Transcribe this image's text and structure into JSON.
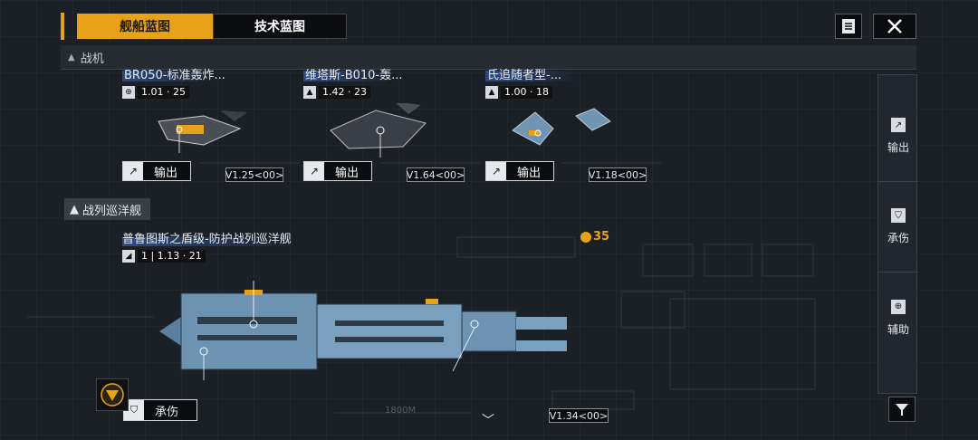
{
  "tabs": {
    "ship_blueprint": "舰船蓝图",
    "tech_blueprint": "技术蓝图"
  },
  "sections": {
    "fighters": "战机",
    "battlecruisers": "战列巡洋舰"
  },
  "fighters": [
    {
      "name": "BR050-标准轰炸...",
      "version": "1.01",
      "version_sub": "25",
      "role": "输出",
      "ver_tag": "V1.25<00>"
    },
    {
      "name": "维塔斯-B010-轰...",
      "version": "1.42",
      "version_sub": "23",
      "role": "输出",
      "ver_tag": "V1.64<00>"
    },
    {
      "name": "氏追随者型-...",
      "version": "1.00",
      "version_sub": "18",
      "role": "输出",
      "ver_tag": "V1.18<00>"
    }
  ],
  "battlecruiser": {
    "name": "普鲁图斯之盾级-防护战列巡洋舰",
    "version": "1.13",
    "version_prefix": "1",
    "version_sub": "21",
    "count": "35",
    "role": "承伤",
    "ver_tag": "V1.34<00>",
    "range_label": "1800M"
  },
  "side_filters": [
    {
      "label": "输出",
      "icon": "arrow-diagonal-icon"
    },
    {
      "label": "承伤",
      "icon": "shield-icon"
    },
    {
      "label": "辅助",
      "icon": "support-icon"
    }
  ],
  "colors": {
    "accent": "#e8a21a",
    "panel": "#0b0d10",
    "background": "#1b2027"
  }
}
